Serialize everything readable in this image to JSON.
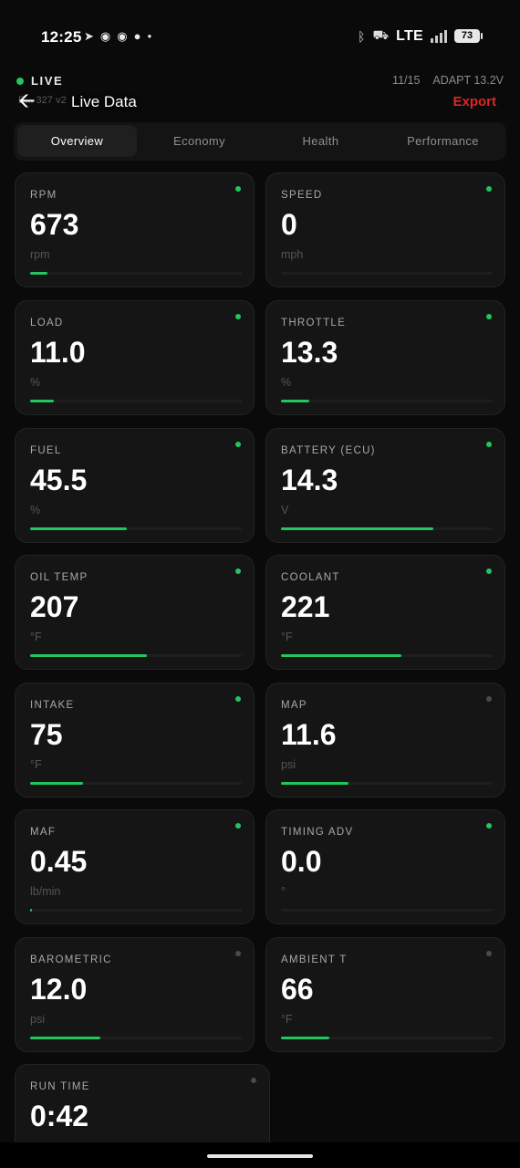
{
  "status_bar": {
    "time": "12:25",
    "notification_icons": [
      "telegram-icon",
      "discord-icon",
      "discord-icon",
      "message-icon",
      "dot-icon"
    ],
    "network": "LTE",
    "battery": "73",
    "icons": [
      "bluetooth-icon",
      "car-icon",
      "signal-icon",
      "battery-icon"
    ]
  },
  "header": {
    "live_label": "LIVE",
    "live_color": "#22c55e",
    "counter": "11/15",
    "adapter": "ADAPT 13.2V",
    "device_id": "E... 327 v2",
    "title": "Live Data",
    "export_label": "Export",
    "export_color": "#dc2626"
  },
  "tabs": [
    {
      "label": "Overview",
      "active": true
    },
    {
      "label": "Economy",
      "active": false
    },
    {
      "label": "Health",
      "active": false
    },
    {
      "label": "Performance",
      "active": false
    }
  ],
  "cards": [
    {
      "label": "RPM",
      "value": "673",
      "unit": "rpm",
      "level": 0.08,
      "status": "active"
    },
    {
      "label": "SPEED",
      "value": "0",
      "unit": "mph",
      "level": 0,
      "status": "active"
    },
    {
      "label": "LOAD",
      "value": "11.0",
      "unit": "%",
      "level": 0.11,
      "status": "active"
    },
    {
      "label": "THROTTLE",
      "value": "13.3",
      "unit": "%",
      "level": 0.133,
      "status": "active"
    },
    {
      "label": "FUEL",
      "value": "45.5",
      "unit": "%",
      "level": 0.455,
      "status": "active"
    },
    {
      "label": "BATTERY (ECU)",
      "value": "14.3",
      "unit": "V",
      "level": 0.72,
      "status": "active"
    },
    {
      "label": "OIL TEMP",
      "value": "207",
      "unit": "°F",
      "level": 0.55,
      "status": "active"
    },
    {
      "label": "COOLANT",
      "value": "221",
      "unit": "°F",
      "level": 0.57,
      "status": "active"
    },
    {
      "label": "INTAKE",
      "value": "75",
      "unit": "°F",
      "level": 0.25,
      "status": "active"
    },
    {
      "label": "MAP",
      "value": "11.6",
      "unit": "psi",
      "level": 0.32,
      "status": "inactive"
    },
    {
      "label": "MAF",
      "value": "0.45",
      "unit": "lb/min",
      "level": 0.005,
      "status": "active"
    },
    {
      "label": "TIMING ADV",
      "value": "0.0",
      "unit": "°",
      "level": 0,
      "status": "active"
    },
    {
      "label": "BAROMETRIC",
      "value": "12.0",
      "unit": "psi",
      "level": 0.33,
      "status": "inactive"
    },
    {
      "label": "AMBIENT T",
      "value": "66",
      "unit": "°F",
      "level": 0.23,
      "status": "inactive"
    },
    {
      "label": "RUN TIME",
      "value": "0:42",
      "unit": "",
      "level": 0,
      "status": "inactive"
    }
  ],
  "status_colors": {
    "active": "#22c55e",
    "inactive": "#4a4a4a"
  }
}
